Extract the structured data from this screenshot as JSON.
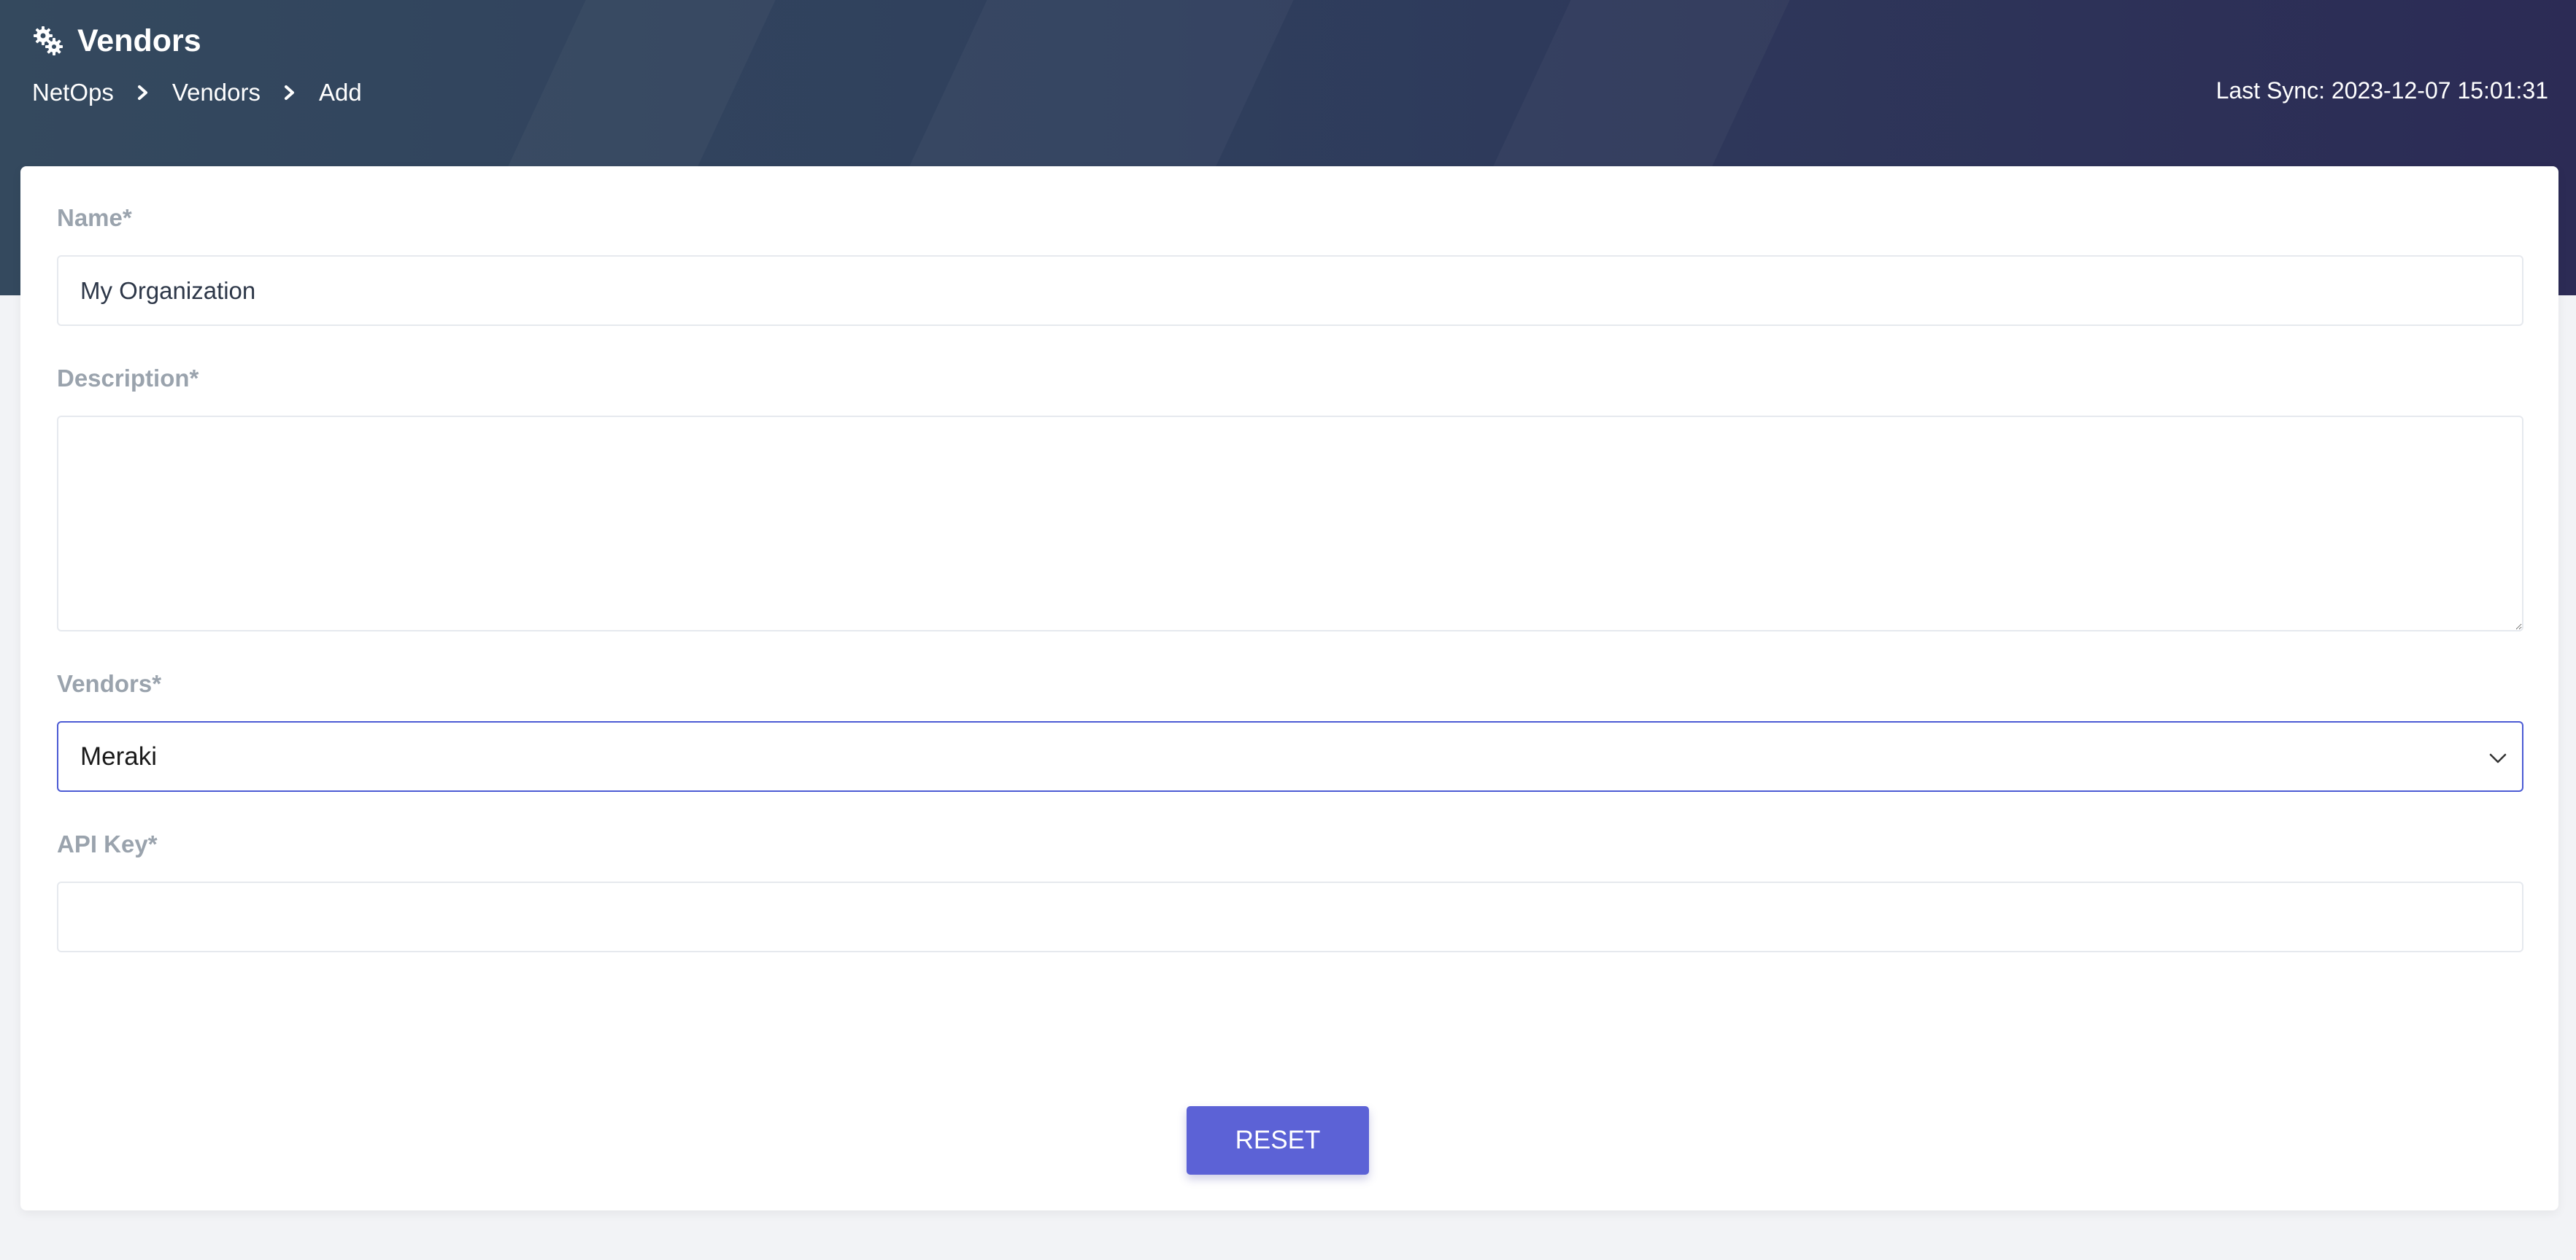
{
  "header": {
    "title": "Vendors",
    "title_icon": "gears-icon",
    "breadcrumb": [
      "NetOps",
      "Vendors",
      "Add"
    ],
    "last_sync": "Last Sync: 2023-12-07 15:01:31"
  },
  "form": {
    "name": {
      "label": "Name*",
      "value": "My Organization"
    },
    "description": {
      "label": "Description*",
      "value": ""
    },
    "vendors": {
      "label": "Vendors*",
      "selected": "Meraki"
    },
    "api_key": {
      "label": "API Key*",
      "value": ""
    },
    "reset_label": "RESET"
  },
  "colors": {
    "header_start": "#34495e",
    "header_end": "#2c2b55",
    "accent": "#5c62d6",
    "select_border": "#4c5bd4",
    "label": "#9aa3ad"
  }
}
